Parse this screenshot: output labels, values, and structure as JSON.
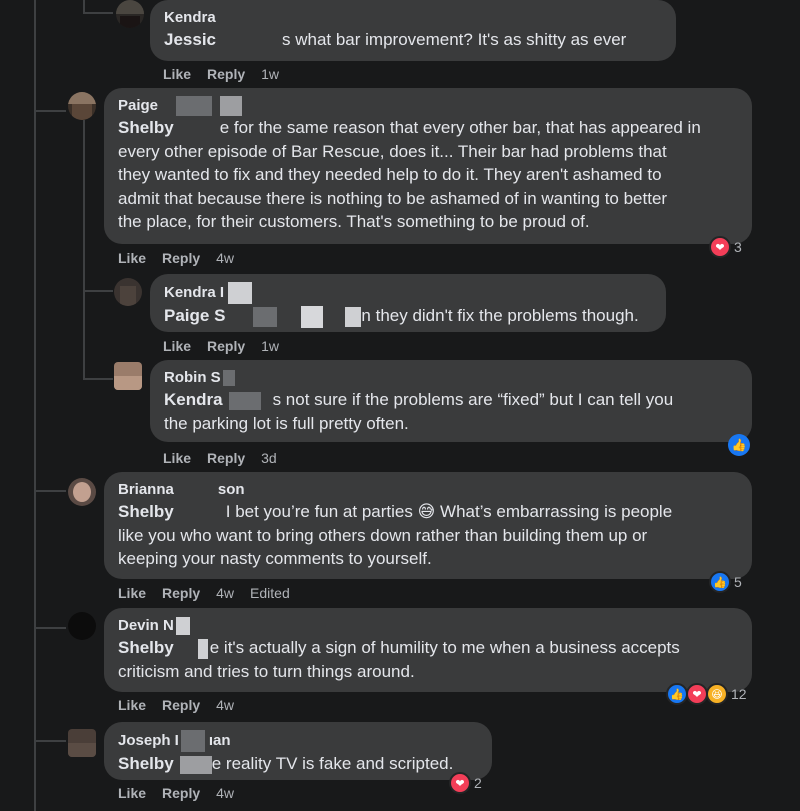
{
  "actions": {
    "like": "Like",
    "reply": "Reply",
    "edited": "Edited"
  },
  "comments": [
    {
      "author": "Kendra",
      "mention": "Jessic",
      "text": "s what bar improvement? It's as shitty as ever",
      "time": "1w"
    },
    {
      "author": "Paige",
      "mention": "Shelby",
      "text_lines": [
        "e for the same reason that every other bar, that has appeared in",
        "every other episode of Bar Rescue, does it... Their bar had problems that",
        "they wanted to fix and they needed help to do it. They aren't ashamed to",
        "admit that because there is nothing to be ashamed of in wanting to better",
        "the place, for their customers. That's something to be proud of."
      ],
      "time": "4w",
      "reaction_count": "3"
    },
    {
      "author": "Kendra I",
      "mention": "Paige S",
      "text": "n they didn't fix the problems though.",
      "time": "1w"
    },
    {
      "author": "Robin S",
      "mention": "Kendra",
      "text_lines": [
        "s not sure if the problems are “fixed” but I can tell you",
        "the parking lot is full pretty often."
      ],
      "time": "3d"
    },
    {
      "author_a": "Brianna",
      "author_b": "son",
      "mention": "Shelby",
      "text_lines": [
        "I bet you’re fun at parties 😅 What’s embarrassing is people",
        "like you who want to bring others down rather than building them up or",
        "keeping your nasty comments to yourself."
      ],
      "time": "4w",
      "reaction_count": "5"
    },
    {
      "author": "Devin N",
      "mention": "Shelby",
      "text_lines": [
        "e it's actually a sign of humility to me when a business accepts",
        "criticism and tries to turn things around."
      ],
      "time": "4w",
      "reaction_count": "12"
    },
    {
      "author_a": "Joseph I",
      "author_b": "ıan",
      "mention": "Shelby",
      "text": "e reality TV is fake and scripted.",
      "time": "4w",
      "reaction_count": "2"
    }
  ],
  "colors": {
    "background": "#18191a",
    "bubble": "#3a3b3c",
    "text": "#e4e6eb",
    "secondary": "#b0b3b8",
    "like_blue": "#1877f2",
    "love_red": "#f33e58",
    "haha_yellow": "#f7b125"
  },
  "icons": [
    "heart-icon",
    "thumbs-up-icon",
    "haha-icon"
  ]
}
